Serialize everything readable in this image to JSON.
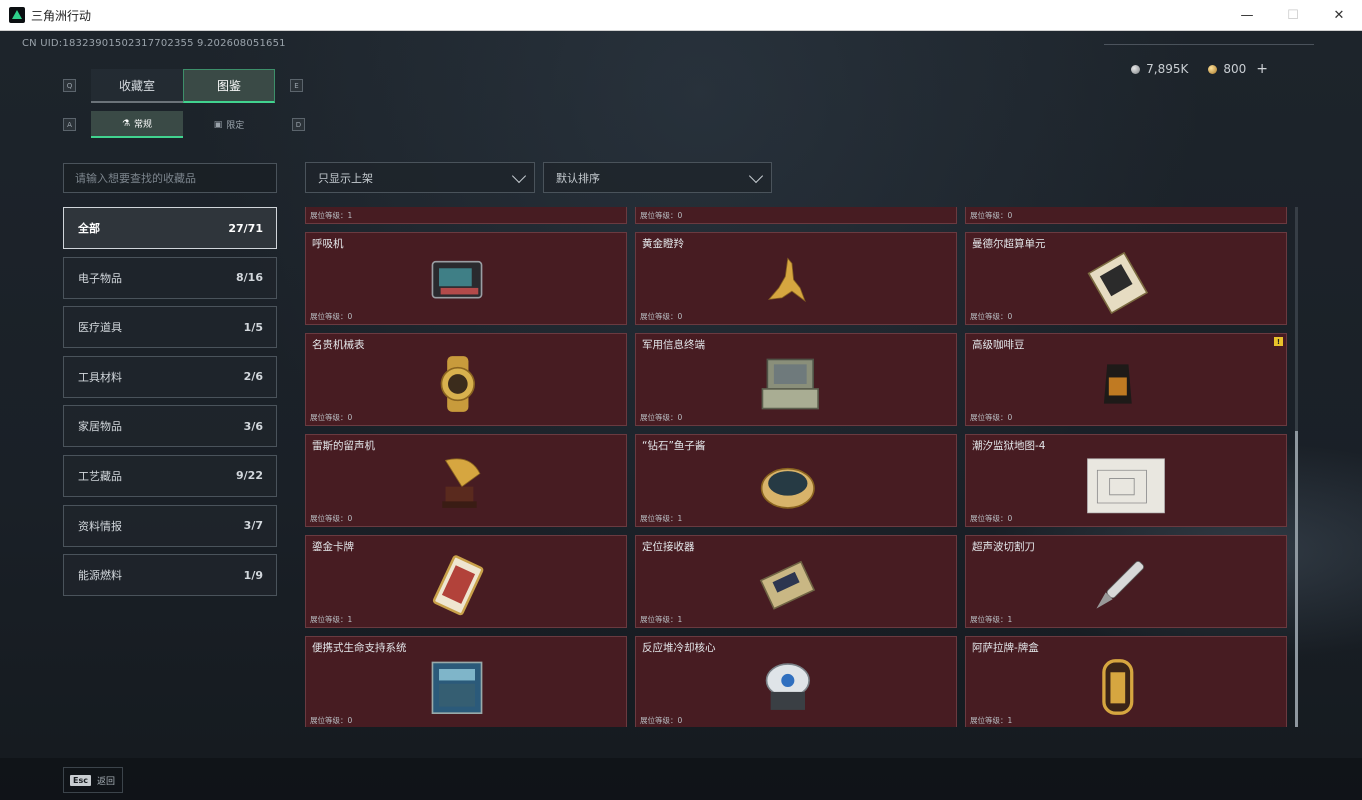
{
  "window": {
    "title": "三角洲行动",
    "minimize": "—",
    "maximize": "☐",
    "close": "✕"
  },
  "uid": "CN UID:18323901502317702355 9.202608051651",
  "currency": {
    "silver": "7,895K",
    "gold": "800",
    "plus": "+"
  },
  "keys": {
    "q": "Q",
    "e": "E",
    "a": "A",
    "d": "D"
  },
  "main_tabs": [
    {
      "label": "收藏室"
    },
    {
      "label": "图鉴"
    }
  ],
  "sub_tabs": [
    {
      "label": "常规"
    },
    {
      "label": "限定"
    }
  ],
  "search": {
    "placeholder": "请输入想要查找的收藏品"
  },
  "filters": {
    "filter": "只显示上架",
    "sort": "默认排序"
  },
  "categories": [
    {
      "label": "全部",
      "count": "27/71"
    },
    {
      "label": "电子物品",
      "count": "8/16"
    },
    {
      "label": "医疗道具",
      "count": "1/5"
    },
    {
      "label": "工具材料",
      "count": "2/6"
    },
    {
      "label": "家居物品",
      "count": "3/6"
    },
    {
      "label": "工艺藏品",
      "count": "9/22"
    },
    {
      "label": "资料情报",
      "count": "3/7"
    },
    {
      "label": "能源燃料",
      "count": "1/9"
    }
  ],
  "items": [
    {
      "name": "",
      "level": "展位等级：1",
      "icon": "gold-item-icon"
    },
    {
      "name": "",
      "level": "展位等级：0",
      "icon": "item-icon"
    },
    {
      "name": "",
      "level": "展位等级：0",
      "icon": "item-icon"
    },
    {
      "name": "呼吸机",
      "level": "展位等级：0",
      "icon": "ventilator-icon"
    },
    {
      "name": "黄金瞪羚",
      "level": "展位等级：0",
      "icon": "golden-gazelle-icon"
    },
    {
      "name": "曼德尔超算单元",
      "level": "展位等级：0",
      "icon": "supercomputer-unit-icon"
    },
    {
      "name": "名贵机械表",
      "level": "展位等级：0",
      "icon": "mechanical-watch-icon"
    },
    {
      "name": "军用信息终端",
      "level": "展位等级：0",
      "icon": "military-terminal-icon"
    },
    {
      "name": "高级咖啡豆",
      "level": "展位等级：0",
      "icon": "coffee-beans-icon",
      "warn": "!"
    },
    {
      "name": "雷斯的留声机",
      "level": "展位等级：0",
      "icon": "gramophone-icon"
    },
    {
      "name": "“钻石”鱼子酱",
      "level": "展位等级：1",
      "icon": "caviar-tin-icon"
    },
    {
      "name": "潮汐监狱地图-4",
      "level": "展位等级：0",
      "icon": "map-icon"
    },
    {
      "name": "鎏金卡牌",
      "level": "展位等级：1",
      "icon": "gilded-card-icon"
    },
    {
      "name": "定位接收器",
      "level": "展位等级：1",
      "icon": "locator-receiver-icon"
    },
    {
      "name": "超声波切割刀",
      "level": "展位等级：1",
      "icon": "ultrasonic-knife-icon"
    },
    {
      "name": "便携式生命支持系统",
      "level": "展位等级：0",
      "icon": "life-support-icon"
    },
    {
      "name": "反应堆冷却核心",
      "level": "展位等级：0",
      "icon": "reactor-core-icon"
    },
    {
      "name": "阿萨拉牌-牌盒",
      "level": "展位等级：1",
      "icon": "card-box-icon"
    }
  ],
  "back": {
    "key": "Esc",
    "label": "返回"
  }
}
